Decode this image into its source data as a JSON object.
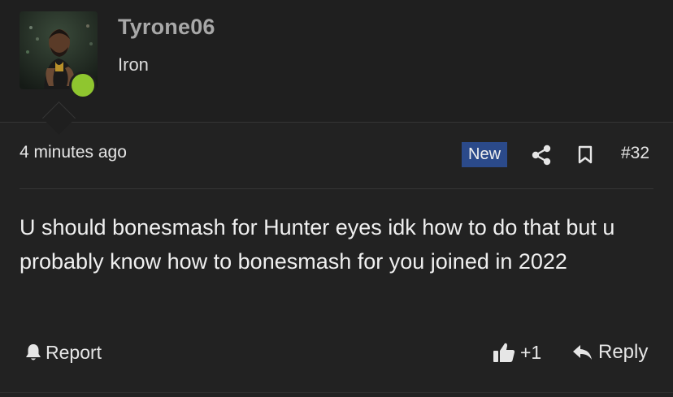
{
  "post": {
    "author": {
      "username": "Tyrone06",
      "rank": "Iron",
      "avatar_icon": "user-avatar-photo",
      "online_status_color": "#8fc62f"
    },
    "timestamp": "4 minutes ago",
    "badge": "New",
    "badge_color": "#2b4a8a",
    "post_number": "#32",
    "message": "U should bonesmash for Hunter eyes idk how to do that but u probably know how to bonesmash for you joined in 2022",
    "actions": {
      "report_label": "Report",
      "like_count": "+1",
      "reply_label": "Reply"
    }
  }
}
